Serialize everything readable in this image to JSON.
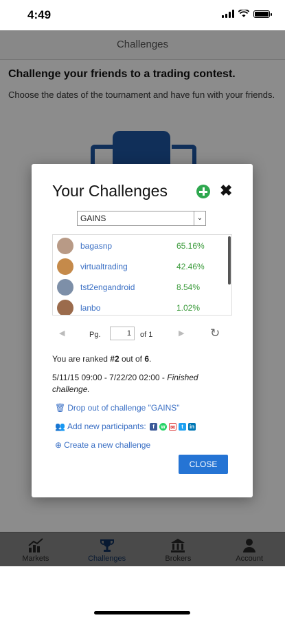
{
  "status": {
    "time": "4:49"
  },
  "nav": {
    "title": "Challenges"
  },
  "intro": {
    "headline": "Challenge your friends to a trading contest.",
    "description": "Choose the dates of the tournament and have fun with your friends."
  },
  "modal": {
    "title": "Your Challenges",
    "selected_challenge": "GAINS",
    "participants": [
      {
        "name": "bagasnp",
        "gain": "65.16%"
      },
      {
        "name": "virtualtrading",
        "gain": "42.46%"
      },
      {
        "name": "tst2engandroid",
        "gain": "8.54%"
      },
      {
        "name": "lanbo",
        "gain": "1.02%"
      }
    ],
    "pager": {
      "pg_label": "Pg.",
      "page": "1",
      "of_label": "of 1"
    },
    "rank": {
      "prefix": "You are ranked ",
      "rank": "#2",
      "middle": " out of ",
      "total": "6",
      "suffix": "."
    },
    "dates": {
      "range": "5/11/15 09:00 - 7/22/20 02:00 - ",
      "status": "Finished challenge."
    },
    "drop_out": "Drop out of challenge \"GAINS\"",
    "add_participants": "Add new participants:",
    "create_new": "Create a new challenge",
    "close": "CLOSE"
  },
  "colors": {
    "accent": "#2574d4",
    "link": "#3a6fc4",
    "positive": "#3a9a3a",
    "add": "#2fa84f"
  },
  "tabs": [
    {
      "label": "Markets",
      "icon": "chart-icon"
    },
    {
      "label": "Challenges",
      "icon": "trophy-icon"
    },
    {
      "label": "Brokers",
      "icon": "bank-icon"
    },
    {
      "label": "Account",
      "icon": "user-icon"
    }
  ]
}
